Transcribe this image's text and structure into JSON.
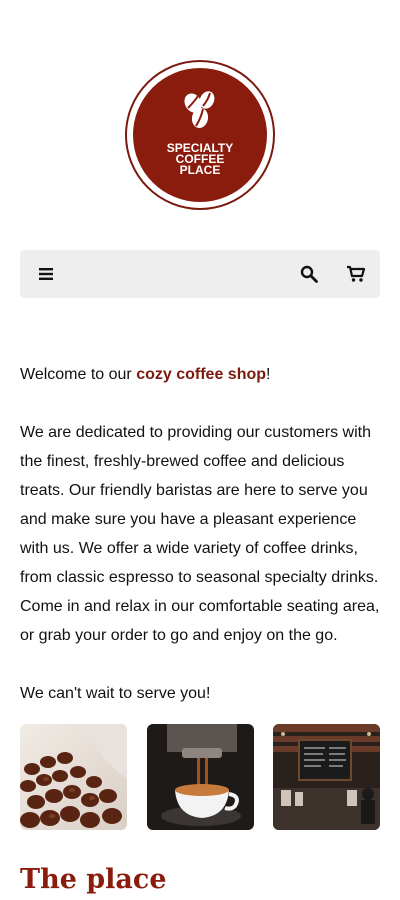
{
  "logo": {
    "text": "SPECIALTY COFFEE PLACE",
    "icon": "coffee-beans-icon",
    "color": "#8a1c0e"
  },
  "nav": {
    "menu_icon": "hamburger-icon",
    "search_icon": "search-icon",
    "cart_icon": "cart-icon"
  },
  "content": {
    "welcome_prefix": "Welcome to our ",
    "welcome_highlight": "cozy coffee shop",
    "welcome_suffix": "!",
    "body": "We are dedicated to providing our customers with the finest, freshly-brewed coffee and delicious treats. Our friendly baristas are here to serve you and make sure you have a pleasant experience with us. We offer a wide variety of coffee drinks, from classic espresso to seasonal specialty drinks. Come in and relax in our comfortable seating area, or grab your order to go and enjoy on the go.",
    "closing": "We can't wait to serve you!"
  },
  "gallery": [
    {
      "subject": "coffee beans"
    },
    {
      "subject": "espresso cup"
    },
    {
      "subject": "coffee shop interior"
    }
  ],
  "section": {
    "title": "The place"
  }
}
